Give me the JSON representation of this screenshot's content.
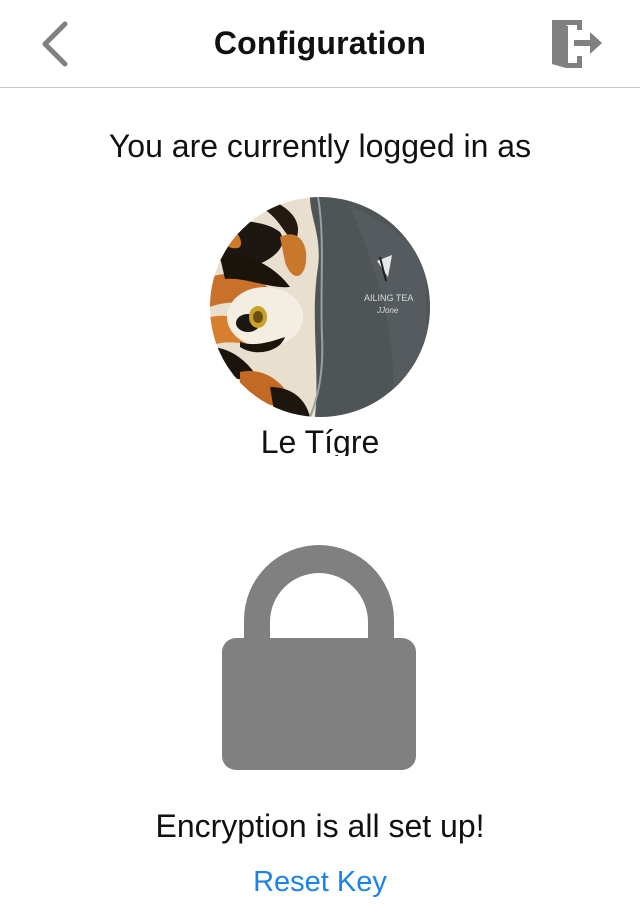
{
  "navbar": {
    "title": "Configuration",
    "back_icon": "chevron-left-icon",
    "logout_icon": "logout-door-icon"
  },
  "account": {
    "logged_in_label": "You are currently logged in as",
    "avatar_icon": "user-avatar-photo",
    "avatar_jacket_text": "SAILING TEA JJone",
    "username": "Le Tígre"
  },
  "security": {
    "lock_icon": "lock-icon",
    "status_text": "Encryption is all set up!",
    "reset_label": "Reset Key"
  },
  "colors": {
    "accent": "#1a82e8",
    "icon_gray": "#808080",
    "divider": "#c8c8c8"
  }
}
